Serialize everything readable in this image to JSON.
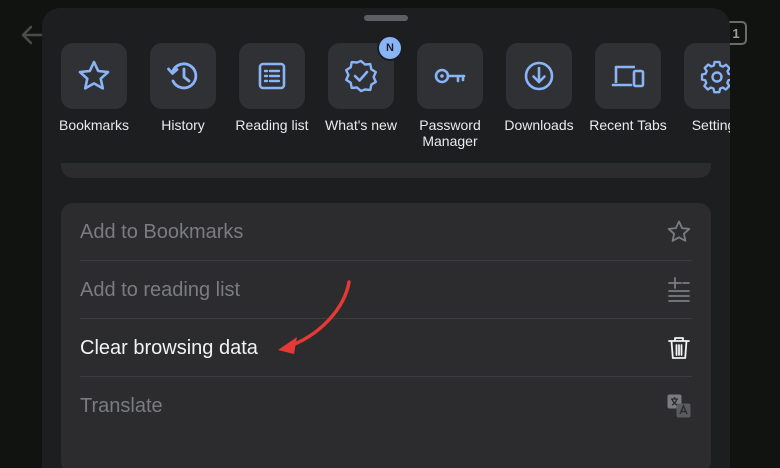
{
  "background": {
    "tab_count": "1"
  },
  "shortcuts": [
    {
      "label": "Bookmarks",
      "icon": "star-icon"
    },
    {
      "label": "History",
      "icon": "history-icon"
    },
    {
      "label": "Reading list",
      "icon": "reading-list-icon"
    },
    {
      "label": "What's new",
      "icon": "whats-new-icon",
      "badge": "N"
    },
    {
      "label": "Password\nManager",
      "icon": "key-icon"
    },
    {
      "label": "Downloads",
      "icon": "download-icon"
    },
    {
      "label": "Recent Tabs",
      "icon": "devices-icon"
    },
    {
      "label": "Settings",
      "icon": "gear-icon"
    }
  ],
  "actions": [
    {
      "label": "Add to Bookmarks",
      "icon": "star-outline-icon",
      "enabled": false
    },
    {
      "label": "Add to reading list",
      "icon": "add-list-icon",
      "enabled": false
    },
    {
      "label": "Clear browsing data",
      "icon": "trash-icon",
      "enabled": true
    },
    {
      "label": "Translate",
      "icon": "translate-icon",
      "enabled": false
    }
  ],
  "colors": {
    "accent": "#8ab4f8",
    "sheet": "#1d1e20",
    "card": "#2c2c2e",
    "annotation_arrow": "#e53935"
  }
}
